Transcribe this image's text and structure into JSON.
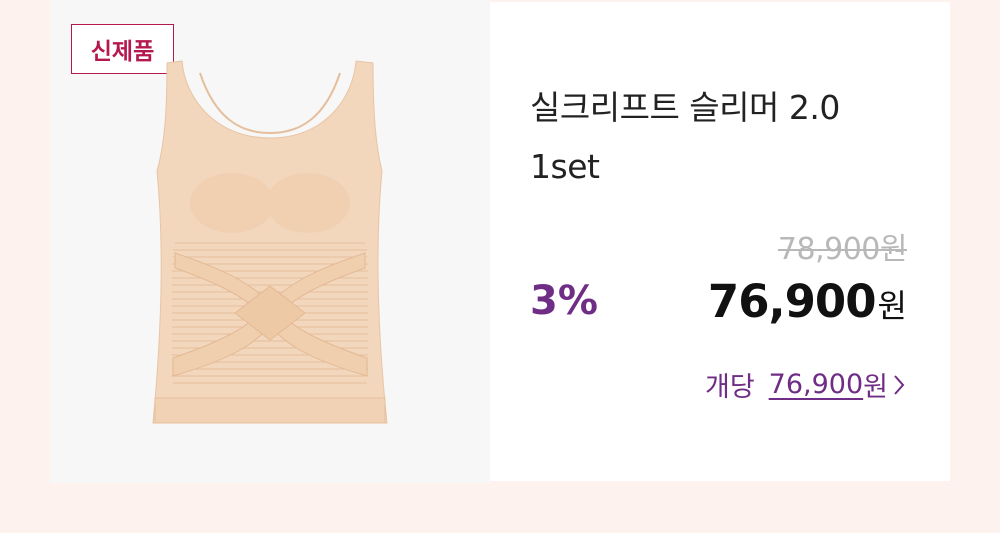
{
  "badge": {
    "label": "신제품"
  },
  "product": {
    "title_line1": "실크리프트 슬리머 2.0",
    "title_line2": "1set",
    "image_icon": "tank-top-shapewear-image"
  },
  "pricing": {
    "original_price": "78,900",
    "original_unit": "원",
    "discount": "3%",
    "sale_price": "76,900",
    "sale_unit": "원",
    "per_unit_label": "개당",
    "per_unit_price": "76,900",
    "per_unit_unit": "원"
  },
  "colors": {
    "background": "#fdf2ee",
    "accent_purple": "#6f2d85",
    "badge_red": "#b5184f",
    "garment": "#f3d7bc"
  }
}
